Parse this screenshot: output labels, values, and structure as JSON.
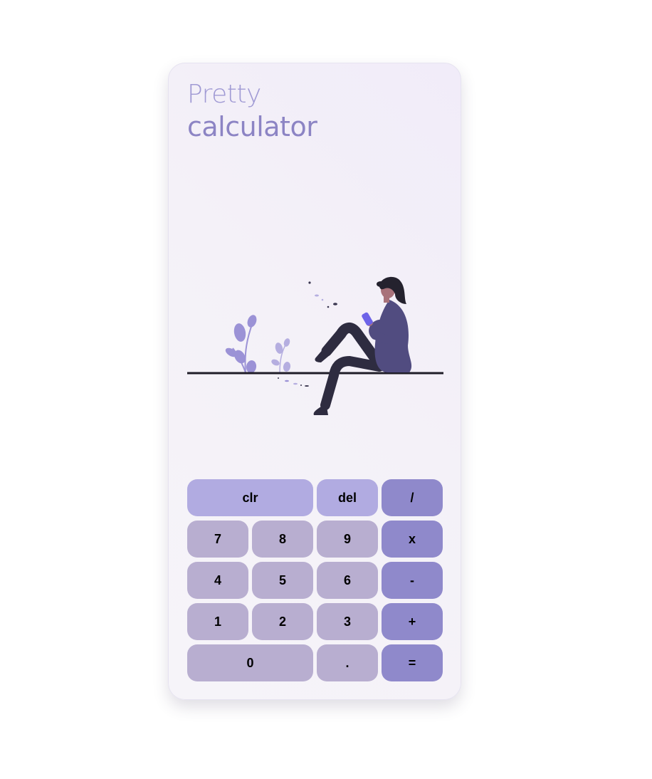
{
  "app": {
    "title_line1": "Pretty",
    "title_line2": "calculator"
  },
  "illustration": {
    "subject": "woman-sitting-with-phone-illustration",
    "colors": {
      "plant": "#9b92d6",
      "plant_light": "#b5aee0",
      "sweater": "#514c80",
      "pants": "#2e2c40",
      "skin": "#a8727a",
      "hair": "#24222e",
      "phone": "#6d63e8",
      "ground": "#1f1d28"
    }
  },
  "keypad": {
    "rows": [
      [
        {
          "label": "clr",
          "kind": "fn",
          "wide": true,
          "name": "clear-button"
        },
        {
          "label": "del",
          "kind": "fn",
          "wide": false,
          "name": "delete-button"
        },
        {
          "label": "/",
          "kind": "op",
          "wide": false,
          "name": "divide-button"
        }
      ],
      [
        {
          "label": "7",
          "kind": "num",
          "wide": false,
          "name": "digit-7-button"
        },
        {
          "label": "8",
          "kind": "num",
          "wide": false,
          "name": "digit-8-button"
        },
        {
          "label": "9",
          "kind": "num",
          "wide": false,
          "name": "digit-9-button"
        },
        {
          "label": "x",
          "kind": "op",
          "wide": false,
          "name": "multiply-button"
        }
      ],
      [
        {
          "label": "4",
          "kind": "num",
          "wide": false,
          "name": "digit-4-button"
        },
        {
          "label": "5",
          "kind": "num",
          "wide": false,
          "name": "digit-5-button"
        },
        {
          "label": "6",
          "kind": "num",
          "wide": false,
          "name": "digit-6-button"
        },
        {
          "label": "-",
          "kind": "op",
          "wide": false,
          "name": "subtract-button"
        }
      ],
      [
        {
          "label": "1",
          "kind": "num",
          "wide": false,
          "name": "digit-1-button"
        },
        {
          "label": "2",
          "kind": "num",
          "wide": false,
          "name": "digit-2-button"
        },
        {
          "label": "3",
          "kind": "num",
          "wide": false,
          "name": "digit-3-button"
        },
        {
          "label": "+",
          "kind": "op",
          "wide": false,
          "name": "add-button"
        }
      ],
      [
        {
          "label": "0",
          "kind": "num",
          "wide": true,
          "name": "digit-0-button"
        },
        {
          "label": ".",
          "kind": "num",
          "wide": false,
          "name": "decimal-button"
        },
        {
          "label": "=",
          "kind": "op",
          "wide": false,
          "name": "equals-button"
        }
      ]
    ]
  },
  "theme": {
    "number_key": "#b8aed0",
    "function_key": "#b1abe1",
    "operator_key": "#8f89cb",
    "title_color": "#8c84c4"
  }
}
